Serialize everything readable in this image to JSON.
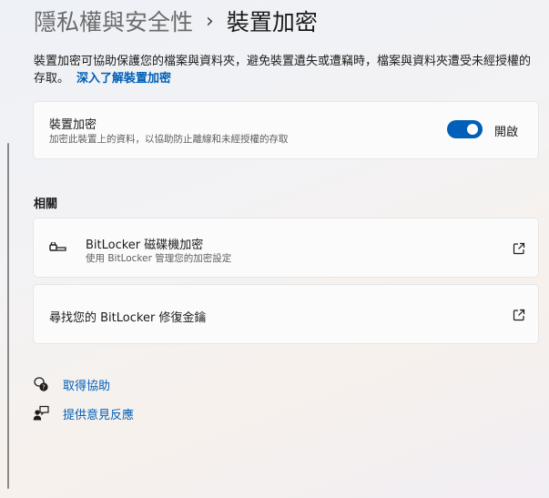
{
  "breadcrumb": {
    "parent": "隱私權與安全性",
    "separator": "›",
    "current": "裝置加密"
  },
  "description": {
    "text": "裝置加密可協助保護您的檔案與資料夾，避免裝置遺失或遭竊時，檔案與資料夾遭受未經授權的存取。",
    "link": "深入了解裝置加密"
  },
  "device_encryption": {
    "title": "裝置加密",
    "subtitle": "加密此裝置上的資料，以協助防止離線和未經授權的存取",
    "toggle_on": true,
    "toggle_label": "開啟"
  },
  "related": {
    "header": "相關",
    "items": [
      {
        "title": "BitLocker 磁碟機加密",
        "subtitle": "使用 BitLocker 管理您的加密設定",
        "icon": "bitlocker-key-icon",
        "action_icon": "open-external-icon"
      },
      {
        "title": "尋找您的 BitLocker 修復金鑰",
        "action_icon": "open-external-icon"
      }
    ]
  },
  "help": {
    "get_help": "取得協助",
    "feedback": "提供意見反應"
  },
  "colors": {
    "accent": "#005fb8",
    "card": "#fbfbfb",
    "card_border": "#e6e6e6"
  }
}
